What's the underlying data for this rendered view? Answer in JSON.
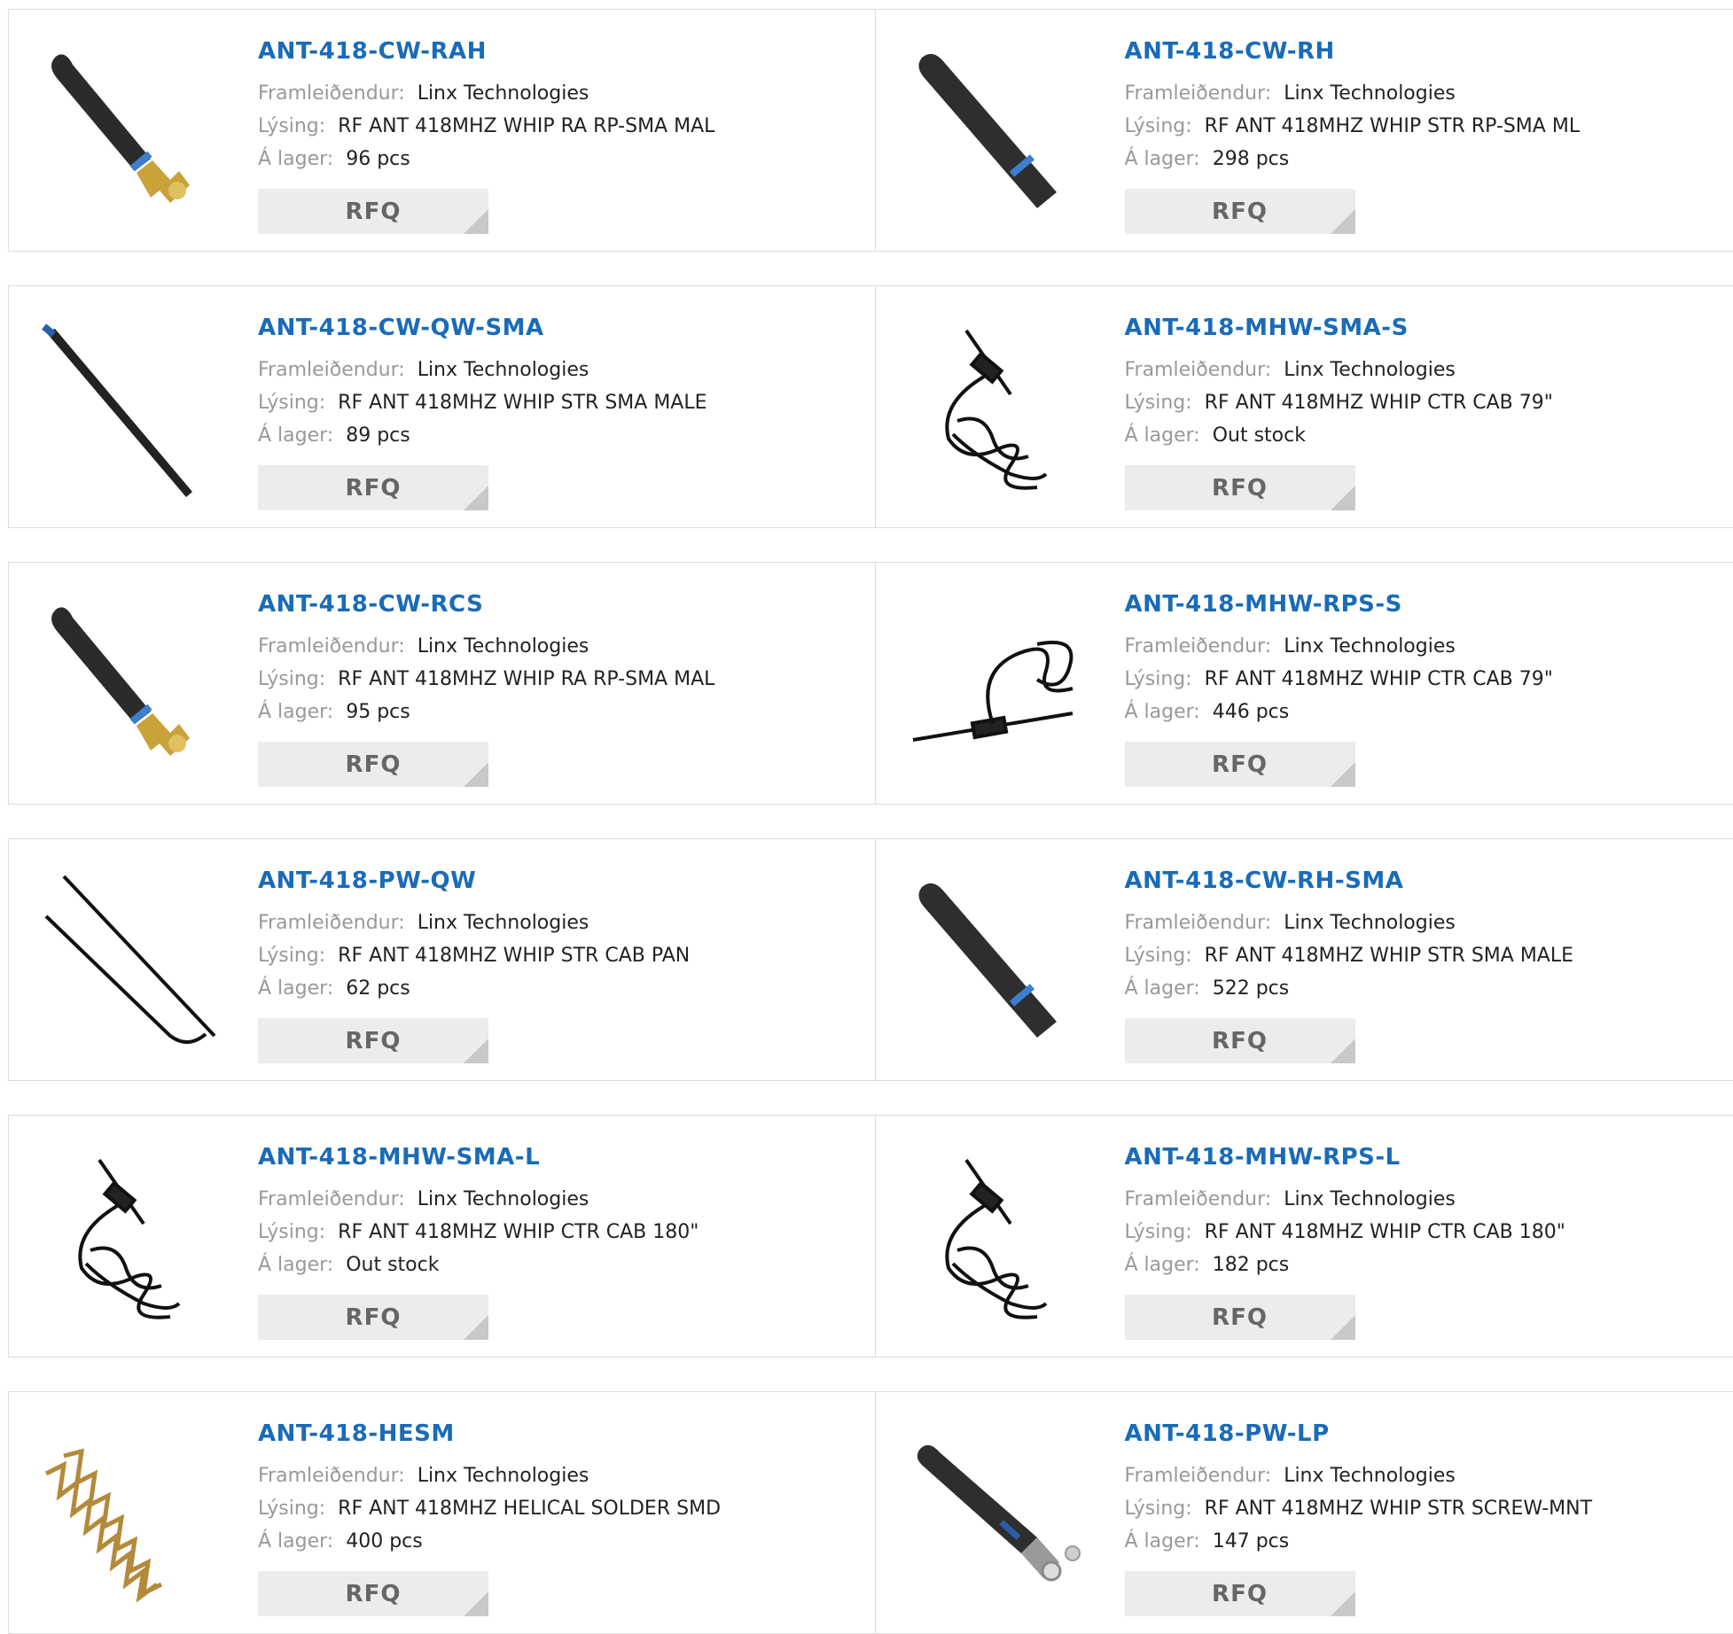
{
  "labels": {
    "manufacturer": "Framleiðendur:",
    "description": "Lýsing:",
    "stock": "Á lager:",
    "rfq": "RFQ"
  },
  "colors": {
    "title": "#1a6bb8",
    "label": "#999999",
    "button_bg": "#ececec"
  },
  "products": [
    {
      "part": "ANT-418-CW-RAH",
      "manufacturer": "Linx Technologies",
      "description": "RF ANT 418MHZ WHIP RA RP-SMA MAL",
      "stock": "96 pcs",
      "icon": "whip-right-angle-antenna"
    },
    {
      "part": "ANT-418-CW-RH",
      "manufacturer": "Linx Technologies",
      "description": "RF ANT 418MHZ WHIP STR RP-SMA ML",
      "stock": "298 pcs",
      "icon": "whip-straight-antenna"
    },
    {
      "part": "ANT-418-CW-QW-SMA",
      "manufacturer": "Linx Technologies",
      "description": "RF ANT 418MHZ WHIP STR SMA MALE",
      "stock": "89 pcs",
      "icon": "thin-whip-antenna"
    },
    {
      "part": "ANT-418-MHW-SMA-S",
      "manufacturer": "Linx Technologies",
      "description": "RF ANT 418MHZ WHIP CTR CAB 79\"",
      "stock": "Out stock",
      "icon": "cable-mount-antenna"
    },
    {
      "part": "ANT-418-CW-RCS",
      "manufacturer": "Linx Technologies",
      "description": "RF ANT 418MHZ WHIP RA RP-SMA MAL",
      "stock": "95 pcs",
      "icon": "whip-right-angle-antenna"
    },
    {
      "part": "ANT-418-MHW-RPS-S",
      "manufacturer": "Linx Technologies",
      "description": "RF ANT 418MHZ WHIP CTR CAB 79\"",
      "stock": "446 pcs",
      "icon": "horizontal-cable-antenna"
    },
    {
      "part": "ANT-418-PW-QW",
      "manufacturer": "Linx Technologies",
      "description": "RF ANT 418MHZ WHIP STR CAB PAN",
      "stock": "62 pcs",
      "icon": "panel-whip-antenna"
    },
    {
      "part": "ANT-418-CW-RH-SMA",
      "manufacturer": "Linx Technologies",
      "description": "RF ANT 418MHZ WHIP STR SMA MALE",
      "stock": "522 pcs",
      "icon": "whip-straight-antenna"
    },
    {
      "part": "ANT-418-MHW-SMA-L",
      "manufacturer": "Linx Technologies",
      "description": "RF ANT 418MHZ WHIP CTR CAB 180\"",
      "stock": "Out stock",
      "icon": "cable-mount-antenna"
    },
    {
      "part": "ANT-418-MHW-RPS-L",
      "manufacturer": "Linx Technologies",
      "description": "RF ANT 418MHZ WHIP CTR CAB 180\"",
      "stock": "182 pcs",
      "icon": "cable-mount-antenna"
    },
    {
      "part": "ANT-418-HESM",
      "manufacturer": "Linx Technologies",
      "description": "RF ANT 418MHZ HELICAL SOLDER SMD",
      "stock": "400 pcs",
      "icon": "helical-coil-antenna"
    },
    {
      "part": "ANT-418-PW-LP",
      "manufacturer": "Linx Technologies",
      "description": "RF ANT 418MHZ WHIP STR SCREW-MNT",
      "stock": "147 pcs",
      "icon": "screw-mount-antenna"
    }
  ]
}
